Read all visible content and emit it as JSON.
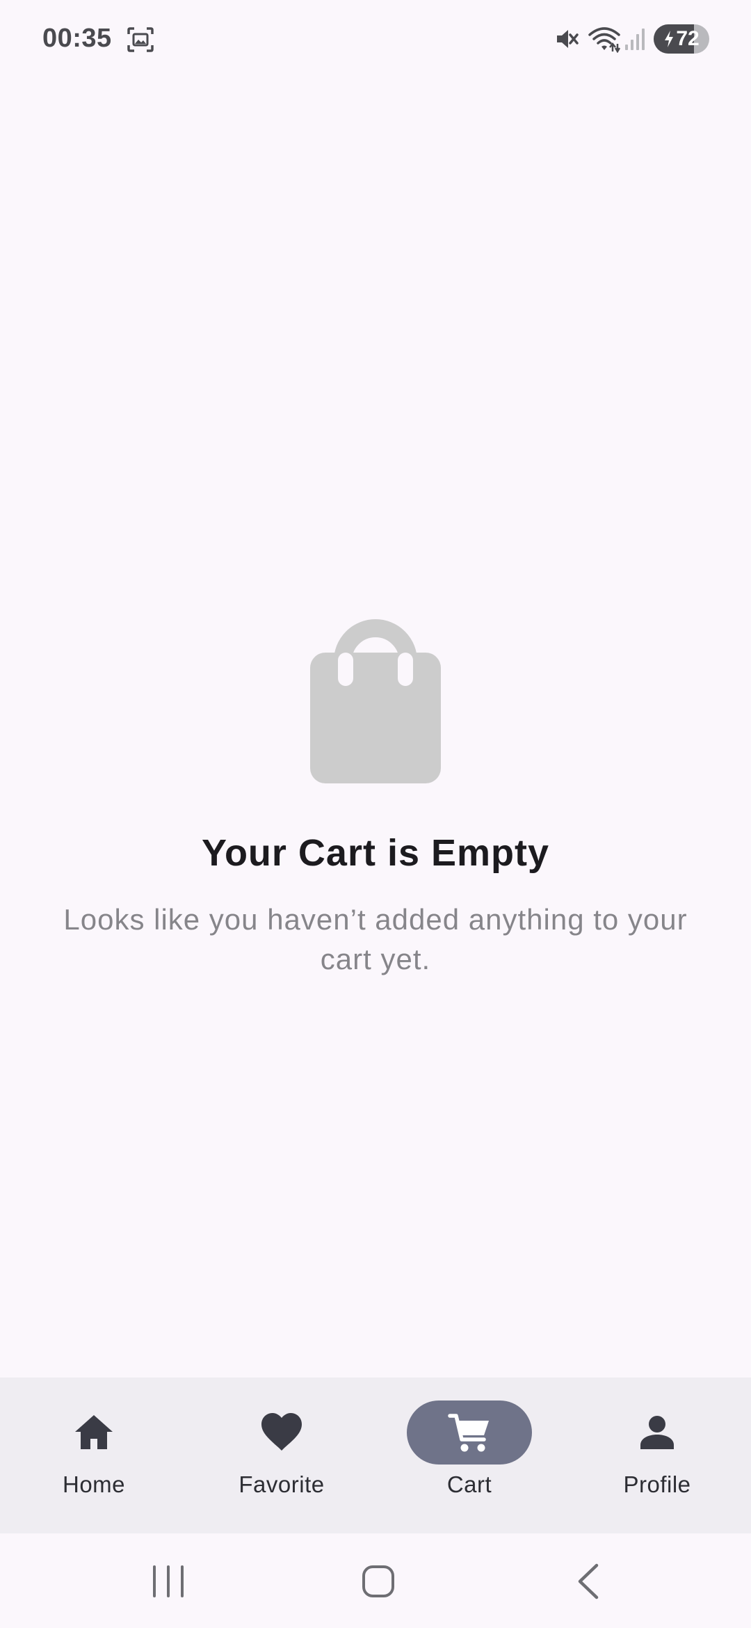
{
  "status_bar": {
    "time": "00:35",
    "battery_level": "72",
    "battery_percent": 72,
    "icons": [
      "screenshot-icon",
      "mute-icon",
      "wifi-icon",
      "signal-icon",
      "battery-charging-icon"
    ]
  },
  "empty_state": {
    "icon": "shopping-bag-icon",
    "title": "Your Cart is Empty",
    "subtitle": "Looks like you haven’t added anything to your cart yet."
  },
  "bottom_nav": {
    "active_tab": "Cart",
    "items": [
      {
        "label": "Home",
        "icon": "home-icon"
      },
      {
        "label": "Favorite",
        "icon": "heart-icon"
      },
      {
        "label": "Cart",
        "icon": "cart-icon"
      },
      {
        "label": "Profile",
        "icon": "person-icon"
      }
    ]
  },
  "system_nav": {
    "buttons": [
      "recent-apps-icon",
      "home-button-icon",
      "back-icon"
    ]
  },
  "colors": {
    "background": "#fbf7fc",
    "nav_background": "#efedf2",
    "active_pill": "#6f7389",
    "icon_dark": "#3a3b45",
    "empty_icon": "#cccccc",
    "title_text": "#1c1b1f",
    "subtitle_text": "#86858a"
  }
}
